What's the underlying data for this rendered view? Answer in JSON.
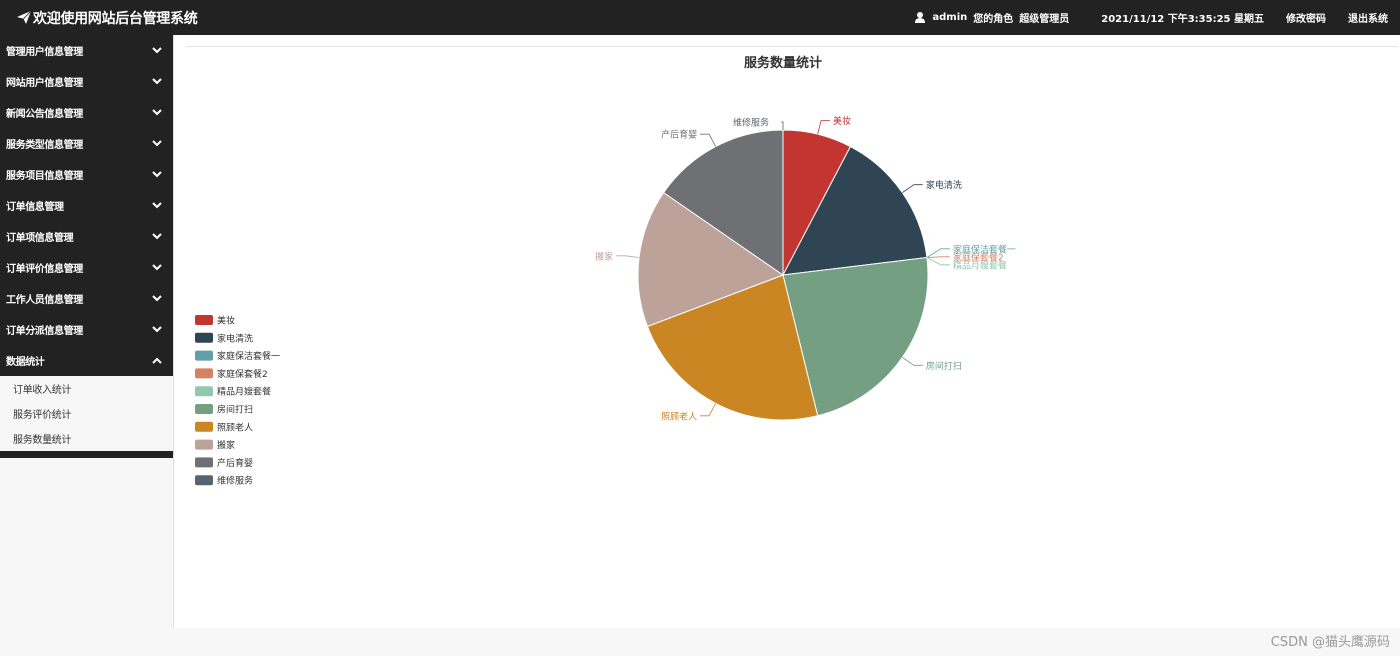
{
  "header": {
    "title": "欢迎使用网站后台管理系统",
    "username": "admin",
    "role_label": "您的角色",
    "role": "超级管理员",
    "datetime": "2021/11/12 下午3:35:25 星期五",
    "change_password": "修改密码",
    "logout": "退出系统"
  },
  "sidebar": {
    "items": [
      {
        "label": "管理用户信息管理"
      },
      {
        "label": "网站用户信息管理"
      },
      {
        "label": "新闻公告信息管理"
      },
      {
        "label": "服务类型信息管理"
      },
      {
        "label": "服务项目信息管理"
      },
      {
        "label": "订单信息管理"
      },
      {
        "label": "订单项信息管理"
      },
      {
        "label": "订单评价信息管理"
      },
      {
        "label": "工作人员信息管理"
      },
      {
        "label": "订单分派信息管理"
      },
      {
        "label": "数据统计",
        "expanded": true
      }
    ],
    "subitems": [
      {
        "label": "订单收入统计"
      },
      {
        "label": "服务评价统计"
      },
      {
        "label": "服务数量统计"
      }
    ]
  },
  "chart_data": {
    "type": "pie",
    "title": "服务数量统计",
    "legend_position": "left",
    "slices": [
      {
        "name": "美妆",
        "value": 1,
        "color": "#c23531"
      },
      {
        "name": "家电清洗",
        "value": 2,
        "color": "#2f4554"
      },
      {
        "name": "家庭保洁套餐一",
        "value": 0,
        "color": "#61a0a8"
      },
      {
        "name": "家庭保套餐2",
        "value": 0,
        "color": "#d48265"
      },
      {
        "name": "精品月嫂套餐",
        "value": 0,
        "color": "#91c7ae"
      },
      {
        "name": "房间打扫",
        "value": 3,
        "color": "#749f83"
      },
      {
        "name": "照顾老人",
        "value": 3,
        "color": "#ca8622"
      },
      {
        "name": "搬家",
        "value": 2,
        "color": "#bda29a"
      },
      {
        "name": "产后育婴",
        "value": 2,
        "color": "#6e7074"
      },
      {
        "name": "维修服务",
        "value": 0,
        "color": "#546570"
      }
    ]
  },
  "watermark": "CSDN @猫头鹰源码"
}
